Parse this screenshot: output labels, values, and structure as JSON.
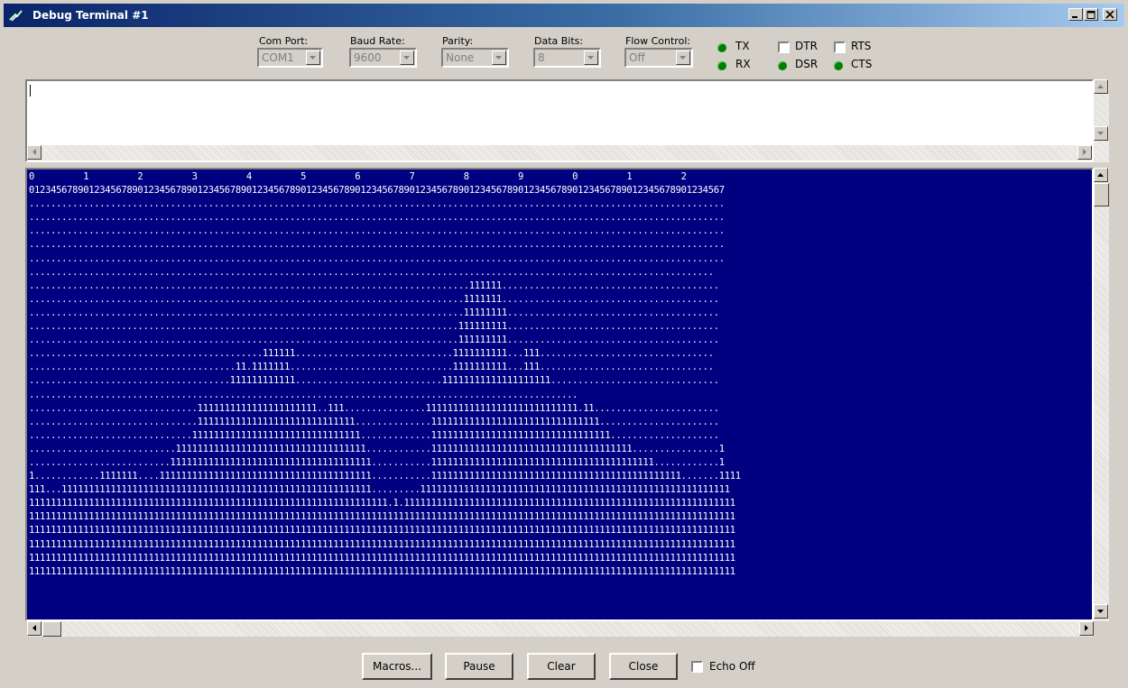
{
  "window": {
    "title": "Debug Terminal #1",
    "accent_color": "#0a246a"
  },
  "settings": {
    "com_port": {
      "label": "Com Port:",
      "value": "COM1"
    },
    "baud_rate": {
      "label": "Baud Rate:",
      "value": "9600"
    },
    "parity": {
      "label": "Parity:",
      "value": "None"
    },
    "data_bits": {
      "label": "Data Bits:",
      "value": "8"
    },
    "flow_control": {
      "label": "Flow Control:",
      "value": "Off"
    }
  },
  "indicators": {
    "tx": "TX",
    "rx": "RX",
    "dsr": "DSR",
    "cts": "CTS",
    "led_color": "#008000"
  },
  "toggles": {
    "dtr": {
      "label": "DTR",
      "checked": false
    },
    "rts": {
      "label": "RTS",
      "checked": false
    }
  },
  "receive": {
    "background": "#000080",
    "lines": [
      "0         1         2         3         4         5         6         7         8         9         0         1         2",
      "01234567890123456789012345678901234567890123456789012345678901234567890123456789012345678901234567890123456789012345678901234567",
      "................................................................................................................................",
      "................................................................................................................................",
      "................................................................................................................................",
      "................................................................................................................................",
      "................................................................................................................................",
      "..............................................................................................................................",
      ".................................................................................111111........................................",
      "................................................................................1111111........................................",
      "................................................................................11111111.......................................",
      "...............................................................................111111111.......................................",
      "...............................................................................111111111.......................................",
      "...........................................111111.............................1111111111...111................................",
      "......................................11.1111111..............................1111111111...111................................",
      ".....................................111111111111...........................11111111111111111111...............................",
      ".....................................................................................................",
      "...............................1111111111111111111111..111...............1111111111111111111111111111.11.......................",
      "...............................11111111111111111111111111111..............1111111111111111111111111111111......................",
      "..............................1111111111111111111111111111111.............111111111111111111111111111111111....................",
      "...........................11111111111111111111111111111111111............1111111111111111111111111111111111111................1",
      "..........................1111111111111111111111111111111111111...........11111111111111111111111111111111111111111............1",
      "1............1111111....111111111111111111111111111111111111111...........1111111111111111111111111111111111111111111111.......1111",
      "111...111111111111111111111111111111111111111111111111111111111.........111111111111111111111111111111111111111111111111111111111",
      "111111111111111111111111111111111111111111111111111111111111111111.1.1111111111111111111111111111111111111111111111111111111111111",
      "1111111111111111111111111111111111111111111111111111111111111111111111111111111111111111111111111111111111111111111111111111111111",
      "1111111111111111111111111111111111111111111111111111111111111111111111111111111111111111111111111111111111111111111111111111111111",
      "1111111111111111111111111111111111111111111111111111111111111111111111111111111111111111111111111111111111111111111111111111111111",
      "1111111111111111111111111111111111111111111111111111111111111111111111111111111111111111111111111111111111111111111111111111111111",
      "1111111111111111111111111111111111111111111111111111111111111111111111111111111111111111111111111111111111111111111111111111111111"
    ]
  },
  "buttons": {
    "macros": "Macros...",
    "pause": "Pause",
    "clear": "Clear",
    "close": "Close",
    "echo_off": "Echo Off"
  }
}
